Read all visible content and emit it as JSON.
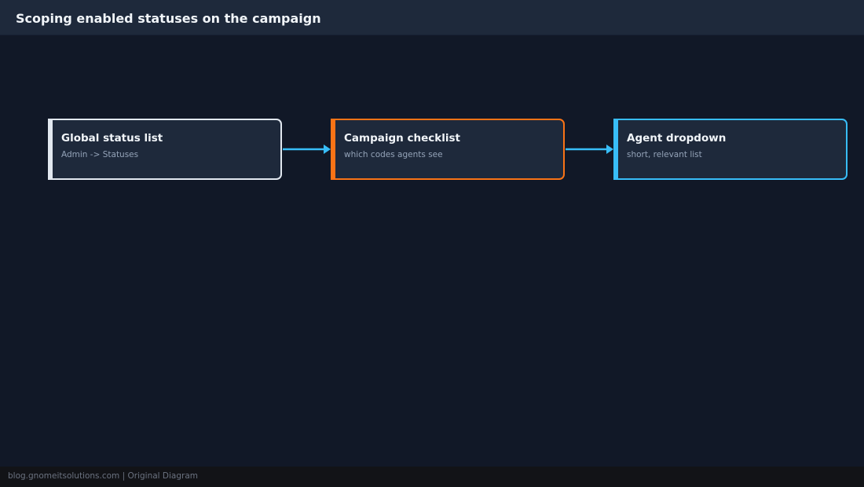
{
  "header": {
    "title": "Scoping enabled statuses on the campaign"
  },
  "diagram": {
    "nodes": [
      {
        "id": "global",
        "title": "Global status list",
        "subtitle": "Admin -> Statuses",
        "color": "#e2e8f0"
      },
      {
        "id": "campaign",
        "title": "Campaign checklist",
        "subtitle": "which codes agents see",
        "color": "#f97316"
      },
      {
        "id": "agent",
        "title": "Agent dropdown",
        "subtitle": "short, relevant list",
        "color": "#38bdf8"
      }
    ],
    "edges": [
      {
        "from": "global",
        "to": "campaign",
        "color": "#38bdf8"
      },
      {
        "from": "campaign",
        "to": "agent",
        "color": "#38bdf8"
      }
    ]
  },
  "footer": {
    "text": "blog.gnomeitsolutions.com | Original Diagram"
  }
}
